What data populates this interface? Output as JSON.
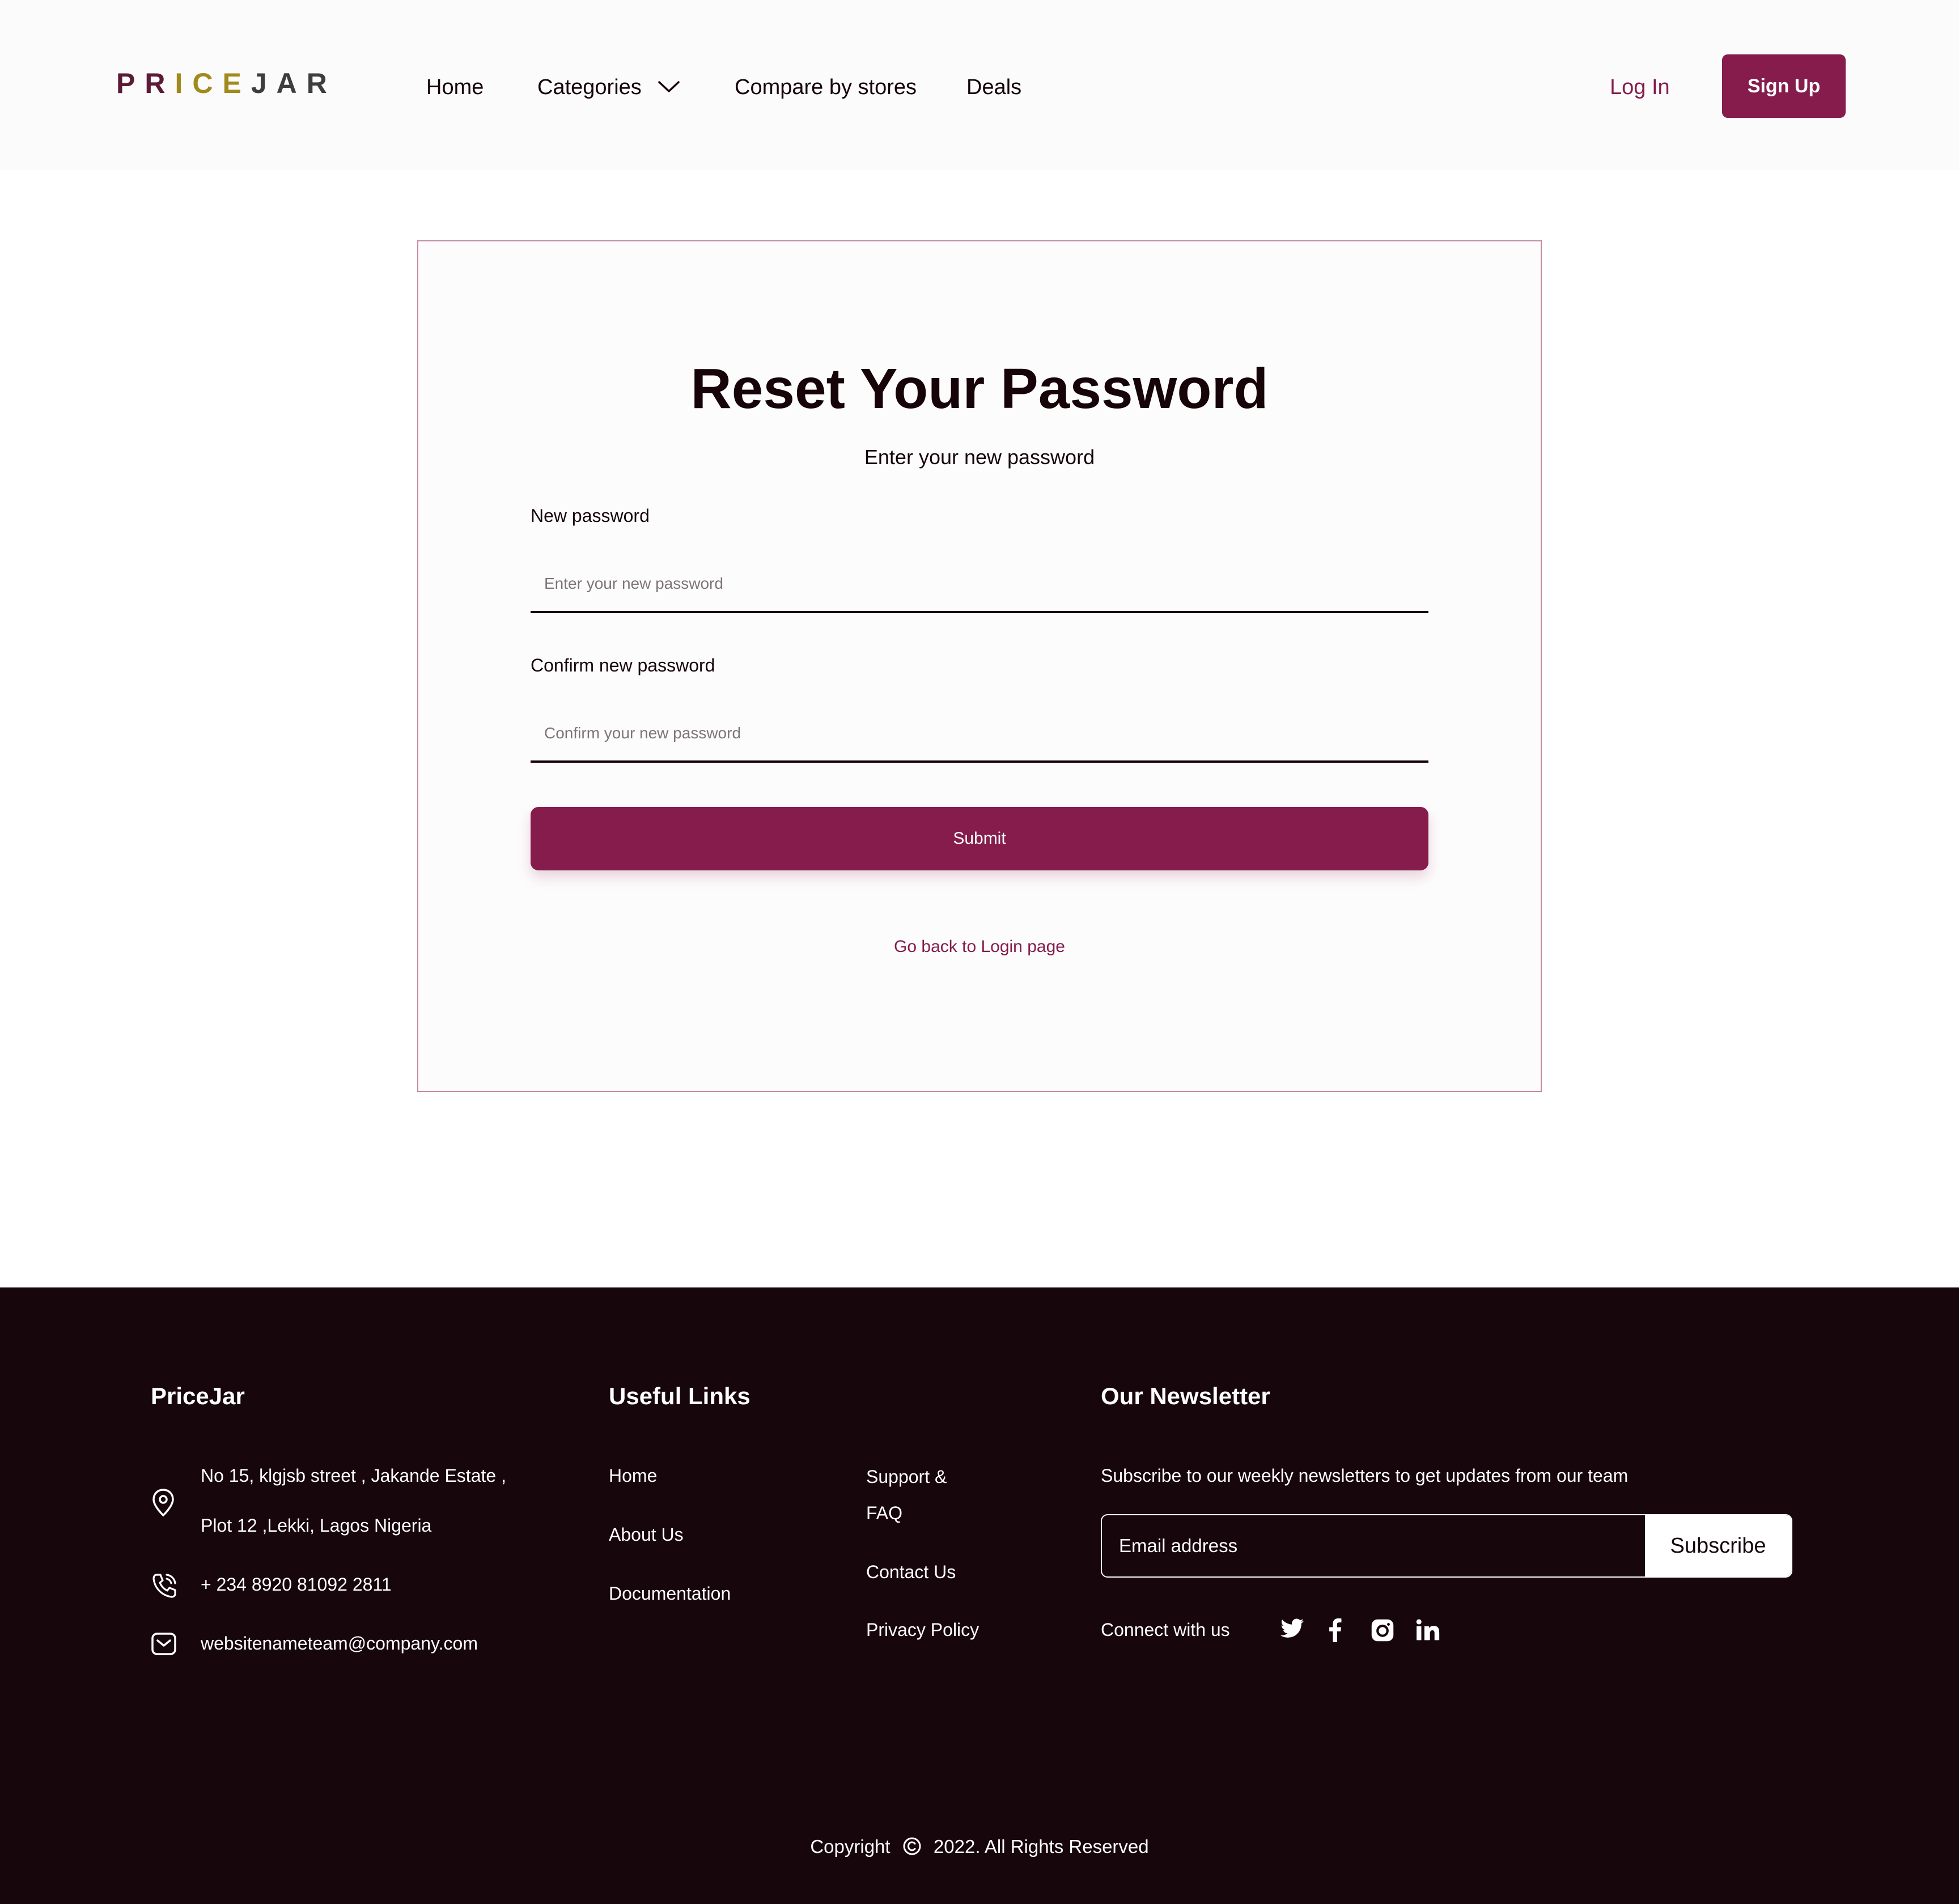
{
  "header": {
    "logo_letters": [
      {
        "char": "P",
        "color": "#5c1a36"
      },
      {
        "char": "R",
        "color": "#5c1a36"
      },
      {
        "char": "I",
        "color": "#a08a1c"
      },
      {
        "char": "C",
        "color": "#a08a1c"
      },
      {
        "char": "E",
        "color": "#a08a1c"
      },
      {
        "char": "J",
        "color": "#3d3d3d"
      },
      {
        "char": "A",
        "color": "#3d3d3d"
      },
      {
        "char": "R",
        "color": "#3d3d3d"
      }
    ],
    "nav": {
      "home": "Home",
      "categories": "Categories",
      "compare": "Compare by stores",
      "deals": "Deals"
    },
    "login_label": "Log In",
    "signup_label": "Sign Up"
  },
  "reset_card": {
    "title": "Reset Your Password",
    "subtitle": "Enter your new password",
    "new_password_label": "New password",
    "new_password_placeholder": "Enter your new password",
    "confirm_password_label": "Confirm new password",
    "confirm_password_placeholder": "Confirm your new password",
    "submit_label": "Submit",
    "back_link": "Go back to Login page"
  },
  "footer": {
    "brand": "PriceJar",
    "address_line1": "No 15, klgjsb street , Jakande Estate ,",
    "address_line2": "Plot 12 ,Lekki, Lagos Nigeria",
    "phone": "+ 234 8920 81092 2811",
    "email": "websitenameteam@company.com",
    "useful_links_heading": "Useful Links",
    "links": {
      "home": "Home",
      "about": "About Us",
      "documentation": "Documentation",
      "support": "Support & FAQ",
      "contact": "Contact Us",
      "privacy": "Privacy Policy"
    },
    "newsletter_heading": "Our Newsletter",
    "newsletter_text": "Subscribe to our weekly newsletters to get updates from our team",
    "email_placeholder": "Email address",
    "subscribe_label": "Subscribe",
    "connect_label": "Connect with us",
    "copyright_prefix": "Copyright",
    "copyright_suffix": "2022. All Rights Reserved"
  },
  "colors": {
    "brand": "#851c4c",
    "footer_bg": "#18060d",
    "text_dark": "#160409"
  },
  "icons": [
    "chevron-down-icon",
    "location-icon",
    "phone-icon",
    "mail-icon",
    "twitter-icon",
    "facebook-icon",
    "instagram-icon",
    "linkedin-icon",
    "copyright-icon"
  ]
}
